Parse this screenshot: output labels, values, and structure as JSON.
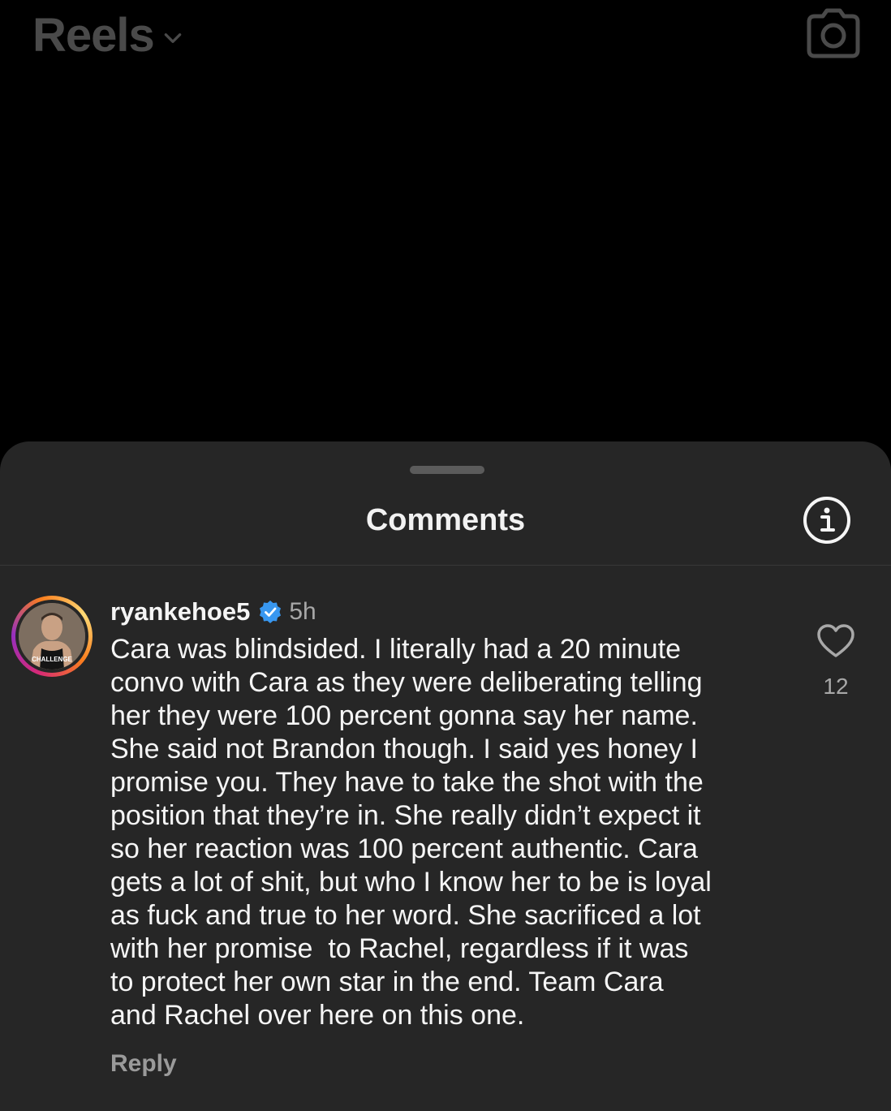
{
  "header": {
    "title": "Reels",
    "chevron_icon": "chevron-down-icon",
    "camera_icon": "camera-icon"
  },
  "sheet": {
    "title": "Comments",
    "info_icon": "info-icon"
  },
  "comment": {
    "username": "ryankehoe5",
    "verified_icon": "verified-badge-icon",
    "timestamp": "5h",
    "text": "Cara was blindsided. I literally had a 20 minute\nconvo with Cara as they were deliberating telling\nher they were 100 percent gonna say her name.\nShe said not Brandon though. I said yes honey I\npromise you. They have to take the shot with the\nposition that they’re in. She really didn’t expect it\nso her reaction was 100 percent authentic. Cara\ngets a lot of shit, but who I know her to be is loyal\nas fuck and true to her word. She sacrificed a lot\nwith her promise  to Rachel, regardless if it was\nto protect her own star in the end. Team Cara\nand Rachel over here on this one.",
    "reply_label": "Reply",
    "like_count": "12",
    "avatar_shirt_text": "CHALLENGE"
  },
  "colors": {
    "background": "#000000",
    "sheet": "#262626",
    "text_primary": "#f5f5f5",
    "text_secondary": "#a8a8a8",
    "verified": "#3897f0"
  }
}
